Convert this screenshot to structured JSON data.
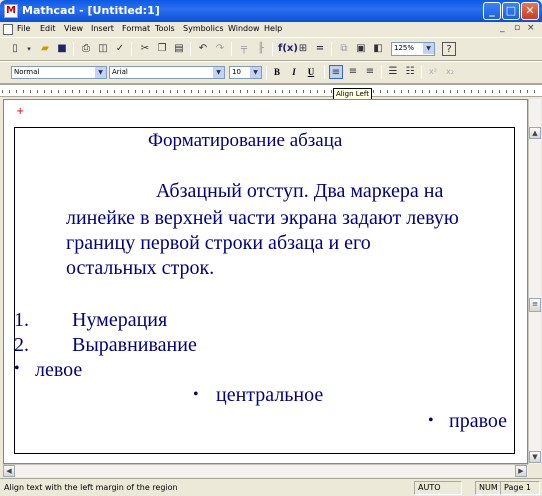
{
  "window": {
    "title": "Mathcad - [Untitled:1]"
  },
  "menu": [
    "File",
    "Edit",
    "View",
    "Insert",
    "Format",
    "Tools",
    "Symbolics",
    "Window",
    "Help"
  ],
  "toolbar": {
    "zoom": "125%"
  },
  "formatting": {
    "style": "Normal",
    "font": "Arial",
    "size": "10",
    "bold": "B",
    "italic": "I",
    "underline": "U"
  },
  "tooltip": "Align Left",
  "document": {
    "heading": "Форматирование абзаца",
    "paragraph_lines": [
      "Абзацный отступ. Два маркера на",
      "линейке в верхней части экрана задают левую",
      "границу первой строки абзаца и его",
      "остальных строк."
    ],
    "numbered": [
      {
        "num": "1.",
        "text": "Нумерация"
      },
      {
        "num": "2.",
        "text": "Выравнивание"
      }
    ],
    "bullets": {
      "left": "левое",
      "center": "центральное",
      "right": "правое"
    }
  },
  "status": {
    "message": "Align text with the left margin of the region",
    "mode": "AUTO",
    "num": "NUM",
    "page": "Page 1"
  },
  "colors": {
    "text": "#000080",
    "titlebar": "#0a5ae6",
    "chrome": "#ece9d8"
  }
}
